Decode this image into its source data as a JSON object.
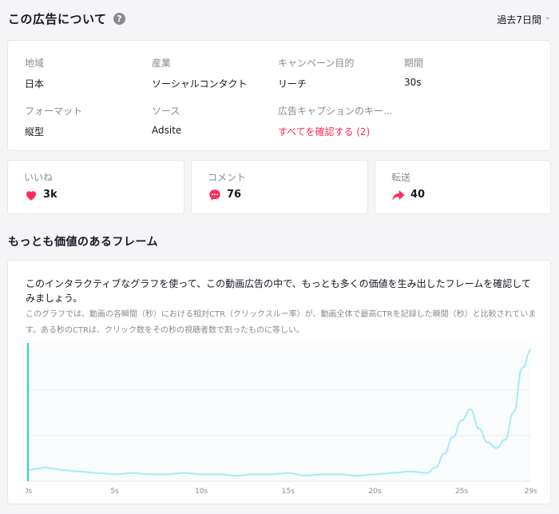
{
  "header": {
    "title": "この広告について",
    "help_icon": "?",
    "period": "過去7日間"
  },
  "info": {
    "fields": [
      {
        "label": "地域",
        "value": "日本"
      },
      {
        "label": "産業",
        "value": "ソーシャルコンタクト"
      },
      {
        "label": "キャンペーン目的",
        "value": "リーチ"
      },
      {
        "label": "期間",
        "value": "30s"
      },
      {
        "label": "フォーマット",
        "value": "縦型"
      },
      {
        "label": "ソース",
        "value": "Adsite"
      },
      {
        "label": "広告キャプションのキー...",
        "value": "すべてを確認する (2)"
      }
    ]
  },
  "stats": [
    {
      "label": "いいね",
      "value": "3k"
    },
    {
      "label": "コメント",
      "value": "76"
    },
    {
      "label": "転送",
      "value": "40"
    }
  ],
  "section": {
    "title": "もっとも価値のあるフレーム",
    "description": "このインタラクティブなグラフを使って、この動画広告の中で、もっとも多くの価値を生み出したフレームを確認してみましょう。",
    "subdescription": "このグラフでは、動画の各瞬間（秒）における相対CTR（クリックスルー率）が、動画全体で最高CTRを記録した瞬間（秒）と比較されています。ある秒のCTRは、クリック数をその秒の視聴者数で割ったものに等しい。"
  },
  "colors": {
    "accent": "#fe2c55",
    "like": "#fe2c55",
    "comment": "#fe2c55",
    "share": "#fe2c55",
    "line": "#a5ecf3",
    "marker": "#20d5c4"
  },
  "chart_data": {
    "type": "line",
    "xlabel": "",
    "ylabel": "",
    "x_ticks": [
      "0s",
      "5s",
      "10s",
      "15s",
      "20s",
      "25s",
      "29s"
    ],
    "xlim": [
      0,
      29
    ],
    "ylim": [
      0,
      1
    ],
    "grid": true,
    "series": [
      {
        "x": [
          0,
          0.5,
          1,
          1.5,
          2,
          3,
          4,
          5,
          6,
          7,
          8,
          9,
          10,
          11,
          12,
          13,
          14,
          15,
          16,
          17,
          18,
          19,
          20,
          21,
          22,
          23,
          23.5,
          24,
          24.5,
          25,
          25.5,
          26,
          26.5,
          27,
          27.5,
          28,
          28.5,
          29
        ],
        "y": [
          0.08,
          0.09,
          0.1,
          0.09,
          0.08,
          0.07,
          0.06,
          0.05,
          0.06,
          0.05,
          0.05,
          0.06,
          0.05,
          0.05,
          0.04,
          0.05,
          0.05,
          0.06,
          0.04,
          0.05,
          0.05,
          0.04,
          0.05,
          0.06,
          0.07,
          0.06,
          0.1,
          0.2,
          0.32,
          0.44,
          0.52,
          0.38,
          0.28,
          0.24,
          0.3,
          0.5,
          0.82,
          0.95
        ]
      }
    ]
  }
}
